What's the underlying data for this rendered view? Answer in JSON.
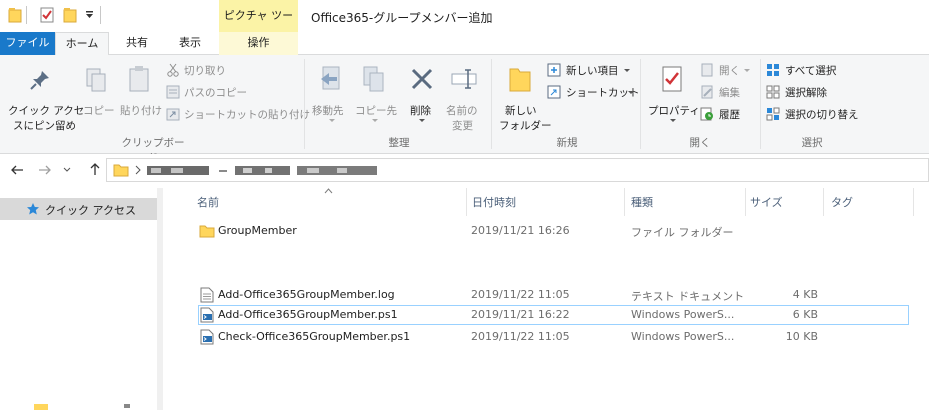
{
  "title_bar": {
    "contextual_tab": "ピクチャ ツール",
    "window_title": "Office365-グループメンバー追加"
  },
  "tabs": {
    "file": "ファイル",
    "home": "ホーム",
    "share": "共有",
    "view": "表示",
    "manage": "操作"
  },
  "ribbon": {
    "clipboard": {
      "pin_quick_access": "クイック アクセス\nにピン留め",
      "pin_line1": "クイック アクセ",
      "pin_line2": "スにピン留め",
      "copy": "コピー",
      "paste": "貼り付け",
      "cut": "切り取り",
      "copy_path": "パスのコピー",
      "paste_shortcut": "ショートカットの貼り付け",
      "group_label": "クリップボード"
    },
    "organize": {
      "move_to": "移動先",
      "copy_to": "コピー先",
      "delete": "削除",
      "rename_line1": "名前の",
      "rename_line2": "変更",
      "group_label": "整理"
    },
    "new": {
      "new_folder_line1": "新しい",
      "new_folder_line2": "フォルダー",
      "new_item": "新しい項目",
      "shortcut": "ショートカット",
      "group_label": "新規"
    },
    "open": {
      "properties": "プロパティ",
      "open": "開く",
      "edit": "編集",
      "history": "履歴",
      "group_label": "開く"
    },
    "select": {
      "select_all": "すべて選択",
      "select_none": "選択解除",
      "invert_selection": "選択の切り替え",
      "group_label": "選択"
    }
  },
  "navpane": {
    "quick_access": "クイック アクセス"
  },
  "columns": {
    "name": "名前",
    "date": "日付時刻",
    "type": "種類",
    "size": "サイズ",
    "tags": "タグ"
  },
  "files": [
    {
      "name": "GroupMember",
      "date": "2019/11/21 16:26",
      "type": "ファイル フォルダー",
      "size": "",
      "icon": "folder-icon"
    },
    {
      "name": "Add-Office365GroupMember.log",
      "date": "2019/11/22 11:05",
      "type": "テキスト ドキュメント",
      "size": "4 KB",
      "icon": "text-file-icon"
    },
    {
      "name": "Add-Office365GroupMember.ps1",
      "date": "2019/11/21 16:22",
      "type": "Windows PowerS...",
      "size": "6 KB",
      "icon": "powershell-file-icon"
    },
    {
      "name": "Check-Office365GroupMember.ps1",
      "date": "2019/11/22 11:05",
      "type": "Windows PowerS...",
      "size": "10 KB",
      "icon": "powershell-file-icon"
    }
  ],
  "colors": {
    "file_tab": "#1979ca",
    "contextual_tab": "#fbf3a6",
    "selection_border": "#99d1ff",
    "folder": "#ffd65c"
  }
}
